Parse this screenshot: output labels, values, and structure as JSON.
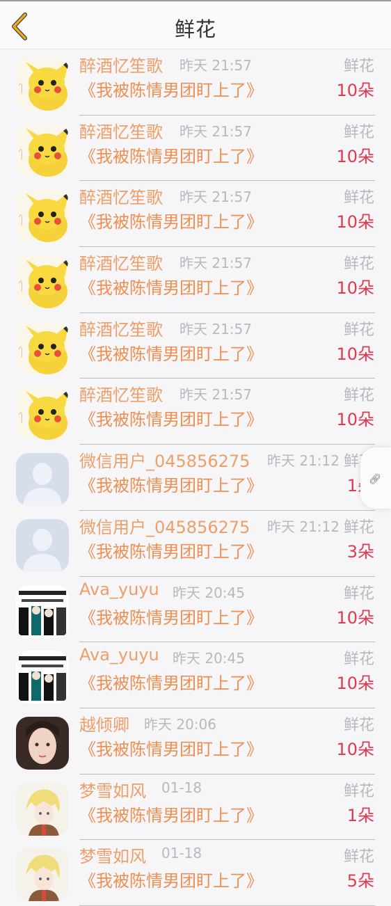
{
  "header": {
    "title": "鲜花",
    "back_icon": "chevron-left-icon"
  },
  "colors": {
    "back_arrow": "#e9ac21",
    "name": "#ee9f68",
    "count": "#e1394f",
    "muted": "#b8b8be"
  },
  "rows": [
    {
      "avatar": "pikachu",
      "name": "醉酒忆笙歌",
      "time": "昨天 21:57",
      "type": "鲜花",
      "book": "《我被陈情男团盯上了》",
      "count": "10朵"
    },
    {
      "avatar": "pikachu",
      "name": "醉酒忆笙歌",
      "time": "昨天 21:57",
      "type": "鲜花",
      "book": "《我被陈情男团盯上了》",
      "count": "10朵"
    },
    {
      "avatar": "pikachu",
      "name": "醉酒忆笙歌",
      "time": "昨天 21:57",
      "type": "鲜花",
      "book": "《我被陈情男团盯上了》",
      "count": "10朵"
    },
    {
      "avatar": "pikachu",
      "name": "醉酒忆笙歌",
      "time": "昨天 21:57",
      "type": "鲜花",
      "book": "《我被陈情男团盯上了》",
      "count": "10朵"
    },
    {
      "avatar": "pikachu",
      "name": "醉酒忆笙歌",
      "time": "昨天 21:57",
      "type": "鲜花",
      "book": "《我被陈情男团盯上了》",
      "count": "10朵"
    },
    {
      "avatar": "pikachu",
      "name": "醉酒忆笙歌",
      "time": "昨天 21:57",
      "type": "鲜花",
      "book": "《我被陈情男团盯上了》",
      "count": "10朵"
    },
    {
      "avatar": "default",
      "name": "微信用户_045856275",
      "time": "昨天 21:12",
      "type": "鲜花",
      "book": "《我被陈情男团盯上了》",
      "count": "1朵"
    },
    {
      "avatar": "default",
      "name": "微信用户_045856275",
      "time": "昨天 21:12",
      "type": "鲜花",
      "book": "《我被陈情男团盯上了》",
      "count": "3朵"
    },
    {
      "avatar": "meme",
      "name": "Ava_yuyu",
      "time": "昨天 20:45",
      "type": "鲜花",
      "book": "《我被陈情男团盯上了》",
      "count": "10朵"
    },
    {
      "avatar": "meme",
      "name": "Ava_yuyu",
      "time": "昨天 20:45",
      "type": "鲜花",
      "book": "《我被陈情男团盯上了》",
      "count": "10朵"
    },
    {
      "avatar": "girl",
      "name": "越倾卿",
      "time": "昨天 20:06",
      "type": "鲜花",
      "book": "《我被陈情男团盯上了》",
      "count": "10朵"
    },
    {
      "avatar": "anime",
      "name": "梦雪如风",
      "time": "01-18",
      "type": "鲜花",
      "book": "《我被陈情男团盯上了》",
      "count": "1朵"
    },
    {
      "avatar": "anime",
      "name": "梦雪如风",
      "time": "01-18",
      "type": "鲜花",
      "book": "《我被陈情男团盯上了》",
      "count": "5朵"
    }
  ],
  "floating_button": {
    "icon": "link-icon"
  }
}
